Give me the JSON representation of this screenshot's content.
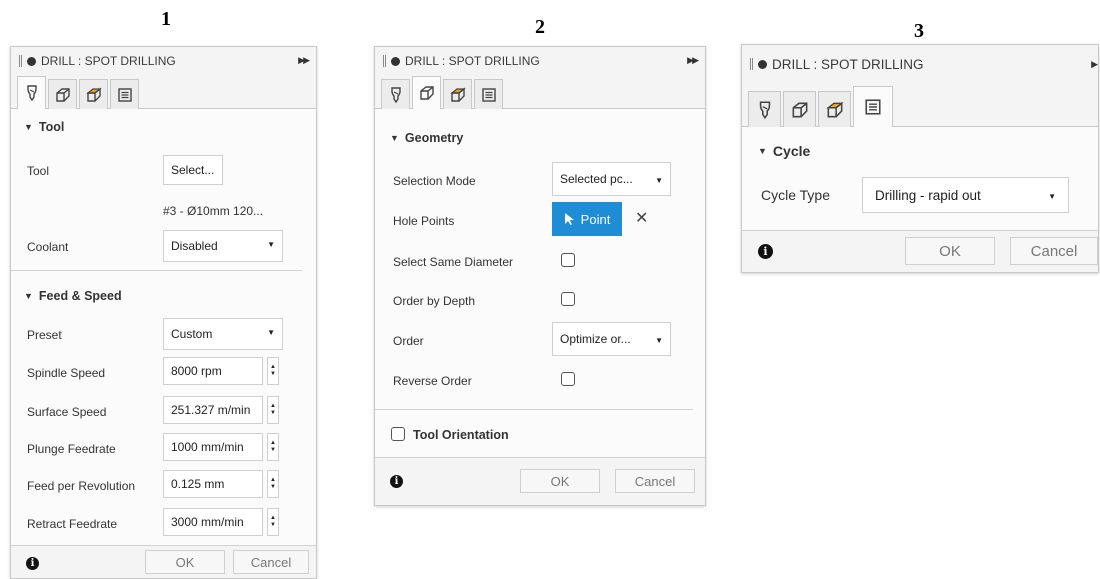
{
  "figure_labels": [
    "1",
    "2",
    "3"
  ],
  "panel1": {
    "title": "DRILL : SPOT DRILLING",
    "tool_section": "Tool",
    "tool_label": "Tool",
    "tool_button": "Select...",
    "tool_desc": "#3 - Ø10mm 120...",
    "coolant_label": "Coolant",
    "coolant_value": "Disabled",
    "feed_section": "Feed & Speed",
    "preset_label": "Preset",
    "preset_value": "Custom",
    "spindle_label": "Spindle Speed",
    "spindle_value": "8000 rpm",
    "surface_label": "Surface Speed",
    "surface_value": "251.327 m/min",
    "plunge_label": "Plunge Feedrate",
    "plunge_value": "1000 mm/min",
    "fpr_label": "Feed per Revolution",
    "fpr_value": "0.125 mm",
    "retract_label": "Retract Feedrate",
    "retract_value": "3000 mm/min",
    "ok": "OK",
    "cancel": "Cancel"
  },
  "panel2": {
    "title": "DRILL : SPOT DRILLING",
    "geometry_section": "Geometry",
    "selection_mode_label": "Selection Mode",
    "selection_mode_value": "Selected pc...",
    "hole_points_label": "Hole Points",
    "point_button": "Point",
    "same_diameter_label": "Select Same Diameter",
    "order_depth_label": "Order by Depth",
    "order_label": "Order",
    "order_value": "Optimize or...",
    "reverse_label": "Reverse Order",
    "tool_orientation_label": "Tool Orientation",
    "ok": "OK",
    "cancel": "Cancel"
  },
  "panel3": {
    "title": "DRILL : SPOT DRILLING",
    "cycle_section": "Cycle",
    "cycle_type_label": "Cycle Type",
    "cycle_type_value": "Drilling - rapid out",
    "ok": "OK",
    "cancel": "Cancel"
  },
  "icons": {
    "tool_tab": "drill-bit-icon",
    "geometry_tab": "geometry-cube-icon",
    "heights_tab": "heights-box-icon",
    "cycle_tab": "cycle-list-icon",
    "info": "info-icon",
    "pointer": "cursor-arrow-icon",
    "clear": "close-icon"
  },
  "colors": {
    "accent": "#1f8dd6",
    "panel_bg": "#f4f4f4",
    "content_bg": "#fbfbfb",
    "heights_icon_fill": "#f5a21b"
  }
}
